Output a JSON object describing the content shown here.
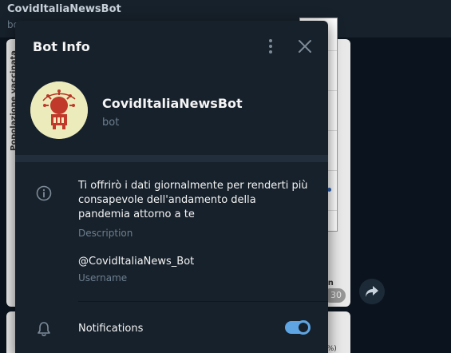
{
  "chat": {
    "title": "CovidItaliaNewsBot",
    "subtitle": "bo",
    "card_axis_label": "Popolazione vaccinata",
    "card_suffix": "an",
    "card_time": "30",
    "card2_label": "5%)"
  },
  "modal": {
    "title": "Bot Info",
    "more_icon": "more-vertical-icon",
    "close_icon": "close-icon"
  },
  "profile": {
    "name": "CovidItaliaNewsBot",
    "status": "bot",
    "avatar_bg": "#ecebbb"
  },
  "info": {
    "description": "Ti offrirò i dati giornalmente per renderti più consapevole dell'andamento della pandemia attorno a te",
    "description_label": "Description",
    "username": "@CovidItaliaNews_Bot",
    "username_label": "Username"
  },
  "notifications": {
    "label": "Notifications",
    "enabled": true
  },
  "colors": {
    "panel_bg": "#17212b",
    "secondary_text": "#6d7f8f",
    "accent": "#5fa5e4"
  }
}
